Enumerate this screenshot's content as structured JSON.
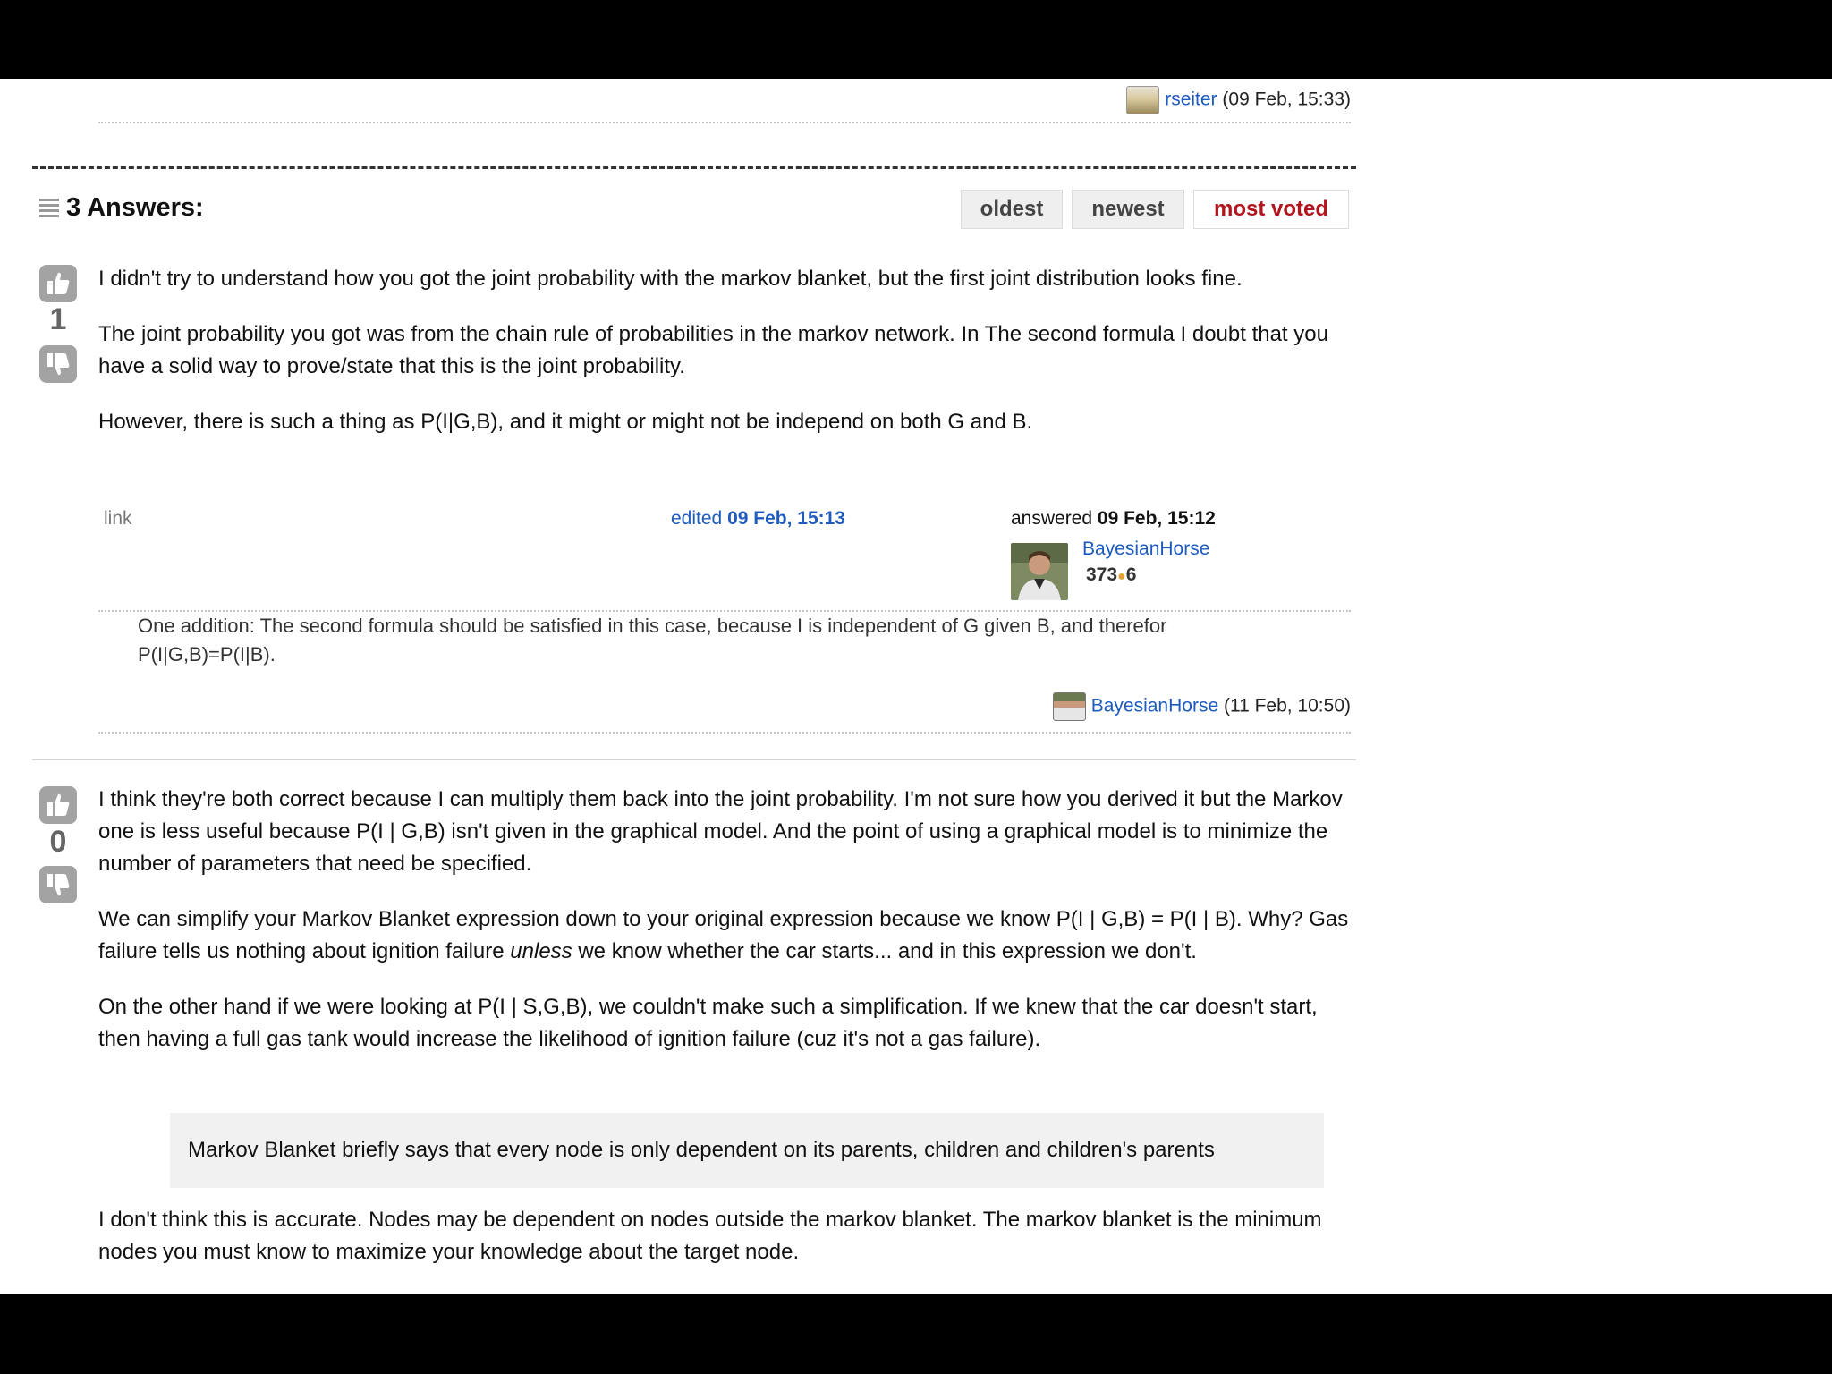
{
  "top_comment": {
    "author": "rseiter",
    "date": "(09 Feb, 15:33)"
  },
  "answers_header": {
    "title": "3 Answers:",
    "sort_tabs": [
      {
        "label": "oldest"
      },
      {
        "label": "newest"
      },
      {
        "label": "most voted"
      }
    ]
  },
  "answer1": {
    "votes": "1",
    "paragraphs": [
      "I didn't try to understand how you got the joint probability with the markov blanket, but the first joint distribution looks fine.",
      "The joint probability you got was from the chain rule of probabilities in the markov network. In The second formula I doubt that you have a solid way to prove/state that this is the joint probability.",
      "However, there is such a thing as P(I|G,B), and it might or might not be independ on both G and B."
    ],
    "link_label": "link",
    "edited_label": "edited",
    "edited_date": "09 Feb, 15:13",
    "answered_label": "answered",
    "answered_date": "09 Feb, 15:12",
    "author": "BayesianHorse",
    "reputation": "373",
    "badge_count": "6",
    "comment": {
      "text": "One addition: The second formula should be satisfied in this case, because I is independent of G given B, and therefor P(I|G,B)=P(I|B).",
      "author": "BayesianHorse",
      "date": "(11 Feb, 10:50)"
    }
  },
  "answer2": {
    "votes": "0",
    "p1": "I think they're both correct because I can multiply them back into the joint probability. I'm not sure how you derived it but the Markov one is less useful because P(I | G,B) isn't given in the graphical model. And the point of using a graphical model is to minimize the number of parameters that need be specified.",
    "p2_before": "We can simplify your Markov Blanket expression down to your original expression because we know P(I | G,B) = P(I | B). Why? Gas failure tells us nothing about ignition failure ",
    "p2_em": "unless",
    "p2_after": " we know whether the car starts... and in this expression we don't.",
    "p3": "On the other hand if we were looking at P(I | S,G,B), we couldn't make such a simplification. If we knew that the car doesn't start, then having a full gas tank would increase the likelihood of ignition failure (cuz it's not a gas failure).",
    "quote": "Markov Blanket briefly says that every node is only dependent on its parents, children and children's parents",
    "p4": "I don't think this is accurate. Nodes may be dependent on nodes outside the markov blanket. The markov blanket is the minimum nodes you must know to maximize your knowledge about the target node."
  },
  "icons": {
    "vote_up": "thumbs-up-icon",
    "vote_down": "thumbs-down-icon",
    "list": "list-icon"
  },
  "colors": {
    "link": "#1e5bbd",
    "active_tab": "#b0141c",
    "vote_button": "#a3a3a3",
    "badge_dot": "#e0a23a"
  }
}
